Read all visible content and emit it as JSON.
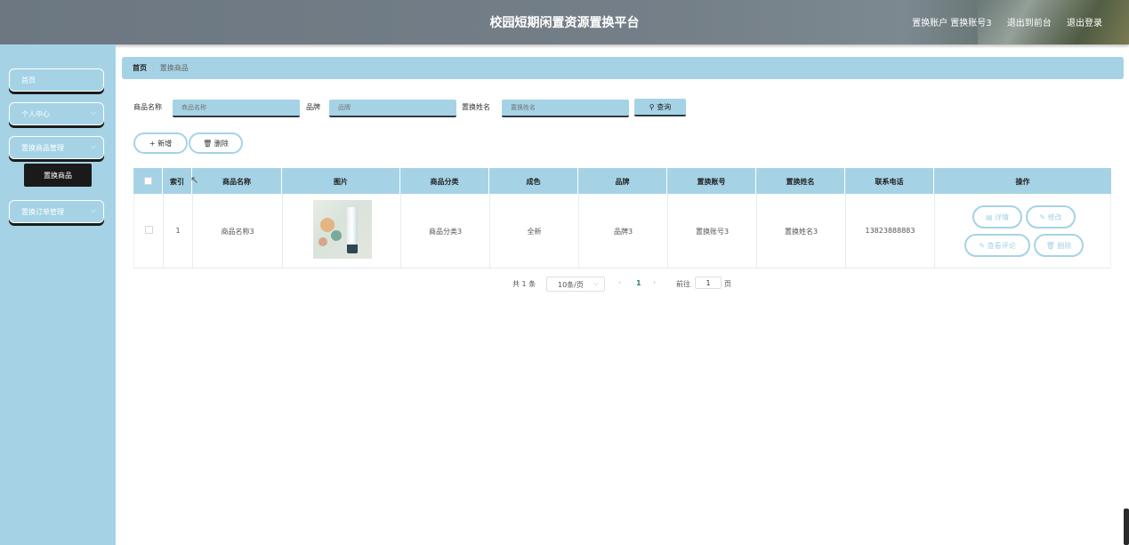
{
  "header": {
    "title": "校园短期闲置资源置换平台",
    "account": "置换账户 置换账号3",
    "to_front": "退出到前台",
    "logout": "退出登录"
  },
  "sidebar": {
    "items": [
      {
        "label": "首页"
      },
      {
        "label": "个人中心"
      },
      {
        "label": "置换商品管理"
      },
      {
        "label": "置换订单管理"
      }
    ],
    "submenu_active": "置换商品"
  },
  "breadcrumb": {
    "home": "首页",
    "current": "置换商品"
  },
  "search": {
    "name_label": "商品名称",
    "name_placeholder": "商品名称",
    "brand_label": "品牌",
    "brand_placeholder": "品牌",
    "owner_label": "置换姓名",
    "owner_placeholder": "置换姓名",
    "query_button": "查询"
  },
  "actions": {
    "add": "新增",
    "delete": "删除"
  },
  "table": {
    "headers": [
      "索引",
      "商品名称",
      "图片",
      "商品分类",
      "成色",
      "品牌",
      "置换账号",
      "置换姓名",
      "联系电话",
      "操作"
    ],
    "rows": [
      {
        "index": "1",
        "name": "商品名称3",
        "category": "商品分类3",
        "condition": "全新",
        "brand": "品牌3",
        "account": "置换账号3",
        "owner": "置换姓名3",
        "phone": "13823888883",
        "ops": {
          "detail": "详情",
          "edit": "修改",
          "review": "查看评论",
          "delete": "删除"
        }
      }
    ]
  },
  "pager": {
    "total": "共 1 条",
    "page_size": "10条/页",
    "current_page": "1",
    "goto_label": "前往",
    "goto_value": "1",
    "page_unit": "页"
  }
}
